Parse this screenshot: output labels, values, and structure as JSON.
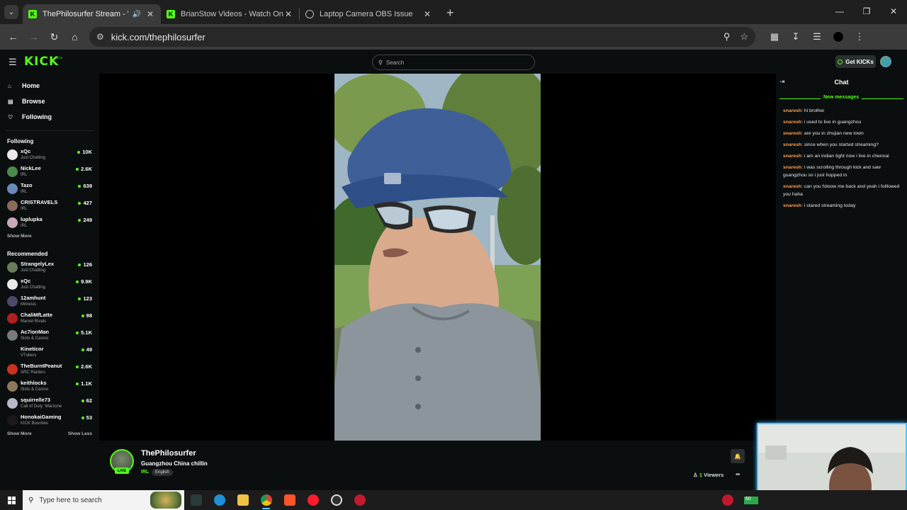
{
  "browser": {
    "tabs": [
      {
        "title": "ThePhilosurfer Stream - Watch Live",
        "favicon": "kick-icon",
        "active": true,
        "audio": true
      },
      {
        "title": "BrianStow Videos - Watch On-Demand",
        "favicon": "kick-icon",
        "active": false,
        "audio": false
      },
      {
        "title": "Laptop Camera OBS Issue",
        "favicon": "globe-icon",
        "active": false,
        "audio": false
      }
    ],
    "url": "kick.com/thephilosurfer"
  },
  "kick": {
    "logo": "KICK",
    "beta": "BETA",
    "search_placeholder": "Search",
    "get_kicks": "Get KICKs",
    "accent": "#53fc18"
  },
  "sidebar": {
    "nav": [
      {
        "label": "Home",
        "icon": "home-icon"
      },
      {
        "label": "Browse",
        "icon": "browse-icon"
      },
      {
        "label": "Following",
        "icon": "heart-icon"
      }
    ],
    "following_title": "Following",
    "following": [
      {
        "name": "xQc",
        "category": "Just Chatting",
        "viewers": "10K",
        "color": "#e8e8e8"
      },
      {
        "name": "NickLee",
        "category": "IRL",
        "viewers": "2.6K",
        "color": "#4a8a4a"
      },
      {
        "name": "Tazo",
        "category": "IRL",
        "viewers": "639",
        "color": "#6a89b8"
      },
      {
        "name": "CRISTRAVELS",
        "category": "IRL",
        "viewers": "427",
        "color": "#8a6a5a"
      },
      {
        "name": "luplupka",
        "category": "IRL",
        "viewers": "249",
        "color": "#c9a9b9"
      }
    ],
    "following_show_more": "Show More",
    "recommended_title": "Recommended",
    "recommended": [
      {
        "name": "StrangelyLex",
        "category": "Just Chatting",
        "viewers": "126",
        "color": "#6a7a5a"
      },
      {
        "name": "xQc",
        "category": "Just Chatting",
        "viewers": "9.9K",
        "color": "#e8e8e8"
      },
      {
        "name": "12amhunt",
        "category": "Mimesis",
        "viewers": "123",
        "color": "#4a4a6a"
      },
      {
        "name": "ChaliMfLatte",
        "category": "Marvel Rivals",
        "viewers": "98",
        "color": "#b02020"
      },
      {
        "name": "Ac7ionMan",
        "category": "Slots & Casino",
        "viewers": "5.1K",
        "color": "#7a7a7a"
      },
      {
        "name": "Kineticor",
        "category": "VTubers",
        "viewers": "49",
        "color": "#0b0e0f"
      },
      {
        "name": "TheBurntPeanut",
        "category": "ARC Raiders",
        "viewers": "2.6K",
        "color": "#c8321e"
      },
      {
        "name": "keithlocks",
        "category": "Slots & Casino",
        "viewers": "1.1K",
        "color": "#8a7a5a"
      },
      {
        "name": "squirrelle73",
        "category": "Call of Duty: Warzone",
        "viewers": "62",
        "color": "#b8b8c8"
      },
      {
        "name": "HonokaiGaming",
        "category": "KICK Bounties",
        "viewers": "53",
        "color": "#1a1a1a"
      }
    ],
    "show_more": "Show More",
    "show_less": "Show Less"
  },
  "stream": {
    "streamer": "ThePhilosurfer",
    "title": "Guangzhou China chillin",
    "category": "IRL",
    "language": "English",
    "live_badge": "LIVE",
    "viewers_count": "1",
    "viewers_label": "Viewers"
  },
  "chat": {
    "title": "Chat",
    "new_messages_label": "New messages",
    "messages": [
      {
        "user": "snaresh",
        "text": "hi brother"
      },
      {
        "user": "snaresh",
        "text": "i used to live in guangzhou"
      },
      {
        "user": "snaresh",
        "text": "are you in zhujian new town"
      },
      {
        "user": "snaresh",
        "text": "since when you started streaming?"
      },
      {
        "user": "snaresh",
        "text": "i am an indian tight now i live in chennai"
      },
      {
        "user": "snaresh",
        "text": "i was scrolling through kick and saw guangzhou so i just hopped in"
      },
      {
        "user": "snaresh",
        "text": "can you foloow me back and yeah i folllowed you haha"
      },
      {
        "user": "snaresh",
        "text": "i stared streaming today"
      }
    ]
  },
  "taskbar": {
    "search_placeholder": "Type here to search",
    "tray_badge": "60"
  }
}
